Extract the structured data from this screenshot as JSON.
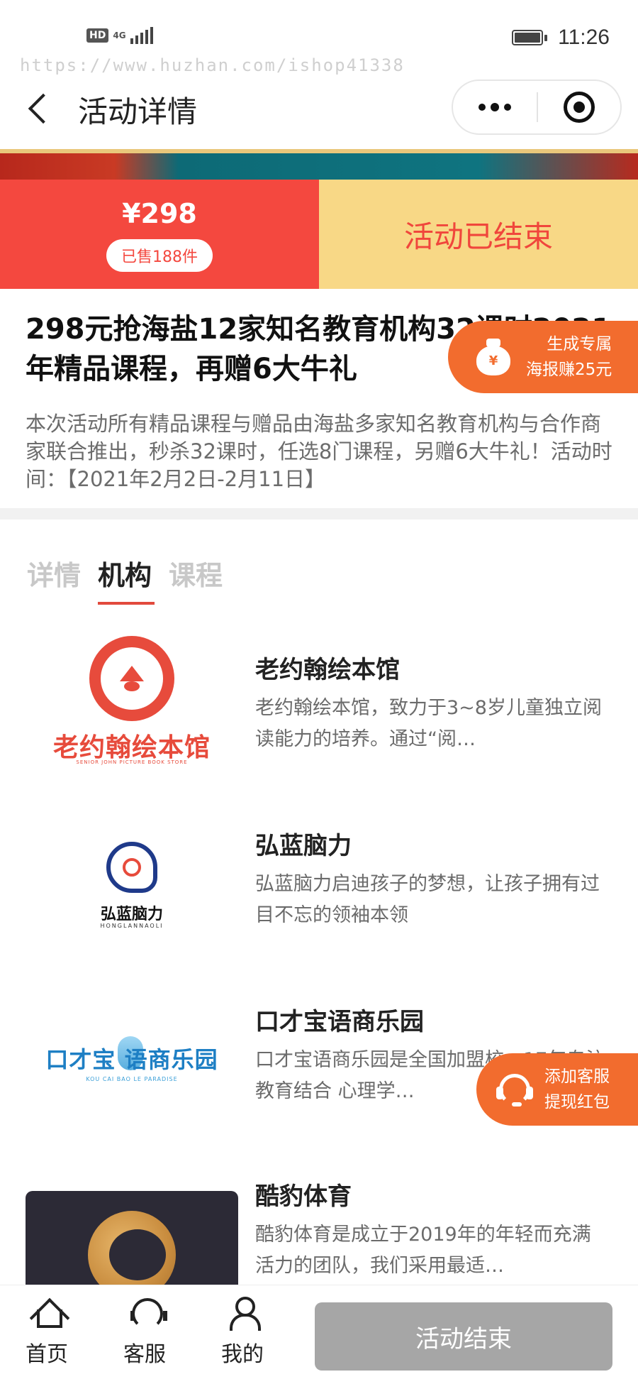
{
  "status_bar": {
    "hd": "HD",
    "network": "4G",
    "time": "11:26"
  },
  "watermark": "https://www.huzhan.com/ishop41338",
  "nav": {
    "title": "活动详情"
  },
  "price": {
    "amount": "¥298",
    "sold": "已售188件",
    "status": "活动已结束"
  },
  "activity": {
    "title": "298元抢海盐12家知名教育机构32课时2021年精品课程，再赠6大牛礼",
    "description": "本次活动所有精品课程与赠品由海盐多家知名教育机构与合作商家联合推出，秒杀32课时，任选8门课程，另赠6大牛礼！活动时间：【2021年2月2日-2月11日】"
  },
  "poster_button": {
    "line1": "生成专属",
    "line2": "海报赚25元"
  },
  "tabs": [
    {
      "label": "详情",
      "active": false
    },
    {
      "label": "机构",
      "active": true
    },
    {
      "label": "课程",
      "active": false
    }
  ],
  "institutions": [
    {
      "name": "老约翰绘本馆",
      "desc": "老约翰绘本馆，致力于3~8岁儿童独立阅读能力的培养。通过“阅…",
      "logo_text": "老约翰绘本馆",
      "logo_sub": "SENIOR JOHN PICTURE BOOK STORE"
    },
    {
      "name": "弘蓝脑力",
      "desc": "弘蓝脑力启迪孩子的梦想，让孩子拥有过目不忘的领袖本领",
      "logo_text": "弘蓝脑力",
      "logo_sub": "HONGLANNAOLI"
    },
    {
      "name": "口才宝语商乐园",
      "desc": "口才宝语商乐园是全国加盟校，17年专注教育结合 心理学…",
      "logo_text": "口才宝 语商乐园",
      "logo_sub": "KOU CAI BAO LE PARADISE"
    },
    {
      "name": "酷豹体育",
      "desc": "酷豹体育是成立于2019年的年轻而充满活力的团队，我们采用最适…"
    }
  ],
  "cs_button": {
    "line1": "添加客服",
    "line2": "提现红包"
  },
  "bottom_bar": {
    "home": "首页",
    "service": "客服",
    "mine": "我的",
    "end_button": "活动结束"
  },
  "colors": {
    "accent_red": "#f4483f",
    "ended_yellow": "#f8d886",
    "floating_orange": "#f26c2e",
    "disabled_gray": "#a6a6a6"
  }
}
